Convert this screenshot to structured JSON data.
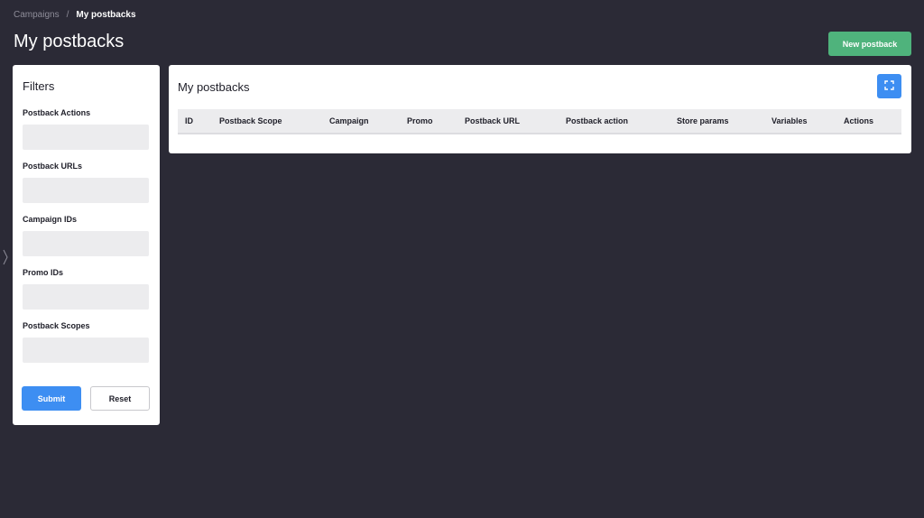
{
  "breadcrumb": {
    "parent": "Campaigns",
    "separator": "/",
    "current": "My postbacks"
  },
  "header": {
    "title": "My postbacks",
    "new_button_label": "New postback"
  },
  "filters": {
    "title": "Filters",
    "fields": [
      {
        "label": "Postback Actions",
        "value": ""
      },
      {
        "label": "Postback URLs",
        "value": ""
      },
      {
        "label": "Campaign IDs",
        "value": ""
      },
      {
        "label": "Promo IDs",
        "value": ""
      },
      {
        "label": "Postback Scopes",
        "value": ""
      }
    ],
    "submit_label": "Submit",
    "reset_label": "Reset"
  },
  "table_panel": {
    "title": "My postbacks",
    "columns": [
      "ID",
      "Postback Scope",
      "Campaign",
      "Promo",
      "Postback URL",
      "Postback action",
      "Store params",
      "Variables",
      "Actions"
    ],
    "rows": []
  },
  "icons": {
    "collapse_handle": "chevron-right-icon",
    "fullscreen": "fullscreen-icon"
  },
  "colors": {
    "background": "#2b2a36",
    "primary": "#3d8ef2",
    "success": "#4fb37c"
  }
}
